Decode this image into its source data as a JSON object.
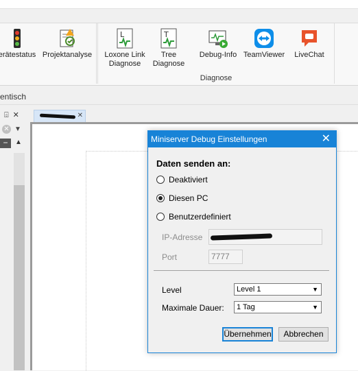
{
  "ribbon": {
    "items": [
      {
        "label": "erätestatus",
        "icon": "traffic-light-icon"
      },
      {
        "label": "Projektanalyse",
        "icon": "project-analysis-icon"
      },
      {
        "label": "Loxone Link Diagnose",
        "icon": "link-diagnosis-icon"
      },
      {
        "label": "Tree Diagnose",
        "icon": "tree-diagnosis-icon"
      },
      {
        "label": "Debug-Info",
        "icon": "debug-info-icon"
      },
      {
        "label": "TeamViewer",
        "icon": "teamviewer-icon"
      },
      {
        "label": "LiveChat",
        "icon": "livechat-icon"
      }
    ],
    "group_label": "Diagnose"
  },
  "breadcrumb": "entisch",
  "left_pane": {
    "pin_glyph": "⌹",
    "close_glyph": "✕"
  },
  "dialog": {
    "title": "Miniserver Debug Einstellungen",
    "send_to_label": "Daten senden an:",
    "options": [
      {
        "label": "Deaktiviert",
        "selected": false
      },
      {
        "label": "Diesen PC",
        "selected": true
      },
      {
        "label": "Benutzerdefiniert",
        "selected": false
      }
    ],
    "ip_label": "IP-Adresse",
    "port_label": "Port",
    "port_value": "7777",
    "level_label": "Level",
    "level_value": "Level 1",
    "duration_label": "Maximale Dauer:",
    "duration_value": "1 Tag",
    "apply_button": "Übernehmen",
    "cancel_button": "Abbrechen"
  },
  "colors": {
    "accent": "#1883d7",
    "teamviewer": "#0e8ee9",
    "livechat": "#e8532b"
  }
}
